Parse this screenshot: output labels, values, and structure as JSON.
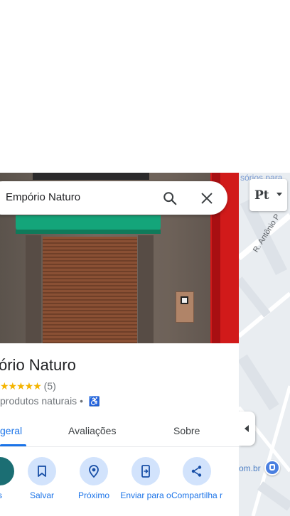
{
  "map": {
    "top_label": "sórios para",
    "street_label": "R. Antônio P",
    "web_label": "om.br"
  },
  "layers": {
    "label": "Pt"
  },
  "search": {
    "value": "Empório Naturo"
  },
  "place": {
    "name": "ório Naturo",
    "rating_count": "(5)",
    "stars": "★★★★★",
    "category": "produtos naturais",
    "separator": "•"
  },
  "tabs": [
    {
      "label": "geral",
      "active": true
    },
    {
      "label": "Avaliações",
      "active": false
    },
    {
      "label": "Sobre",
      "active": false
    }
  ],
  "actions": [
    {
      "label": "s",
      "icon": "directions-icon"
    },
    {
      "label": "Salvar",
      "icon": "bookmark-icon"
    },
    {
      "label": "Próximo",
      "icon": "nearby-icon"
    },
    {
      "label": "Enviar para o",
      "icon": "send-to-phone-icon"
    },
    {
      "label": "Compartilha r",
      "icon": "share-icon"
    }
  ],
  "colors": {
    "accent": "#1a73e8",
    "action_bg": "#d2e3fc",
    "awning": "#14a57a",
    "star": "#f4b400"
  }
}
